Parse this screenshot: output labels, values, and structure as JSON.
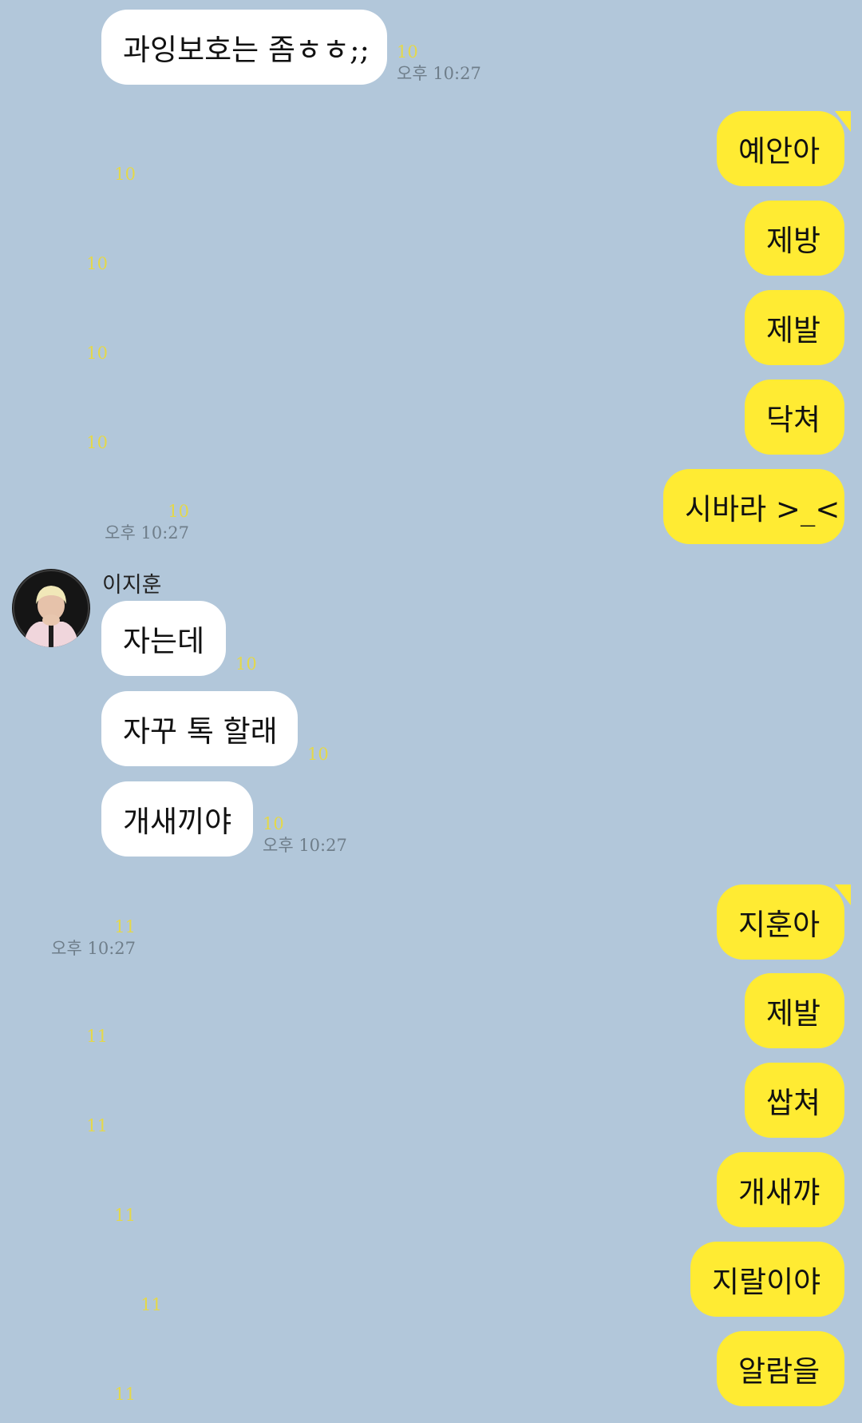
{
  "theme": {
    "background": "#b2c7da",
    "outgoing_bubble": "#ffeb33",
    "incoming_bubble": "#ffffff",
    "read_count_color": "#e4d84a",
    "timestamp_color": "#6f7e8a"
  },
  "contact": {
    "name": "이지훈",
    "avatar_icon": "profile-photo-icon"
  },
  "messages": [
    {
      "dir": "in",
      "text": "과잉보호는 좀ㅎㅎ;;",
      "read": "10",
      "time": "오후 10:27"
    },
    {
      "dir": "out",
      "text": "예안아",
      "read": "10",
      "time": ""
    },
    {
      "dir": "out",
      "text": "제방",
      "read": "10",
      "time": ""
    },
    {
      "dir": "out",
      "text": "제발",
      "read": "10",
      "time": ""
    },
    {
      "dir": "out",
      "text": "닥쳐",
      "read": "10",
      "time": ""
    },
    {
      "dir": "out",
      "text": "시바라 >_<",
      "read": "10",
      "time": "오후 10:27"
    },
    {
      "dir": "in",
      "text": "자는데",
      "read": "10",
      "time": ""
    },
    {
      "dir": "in",
      "text": "자꾸 톡 할래",
      "read": "10",
      "time": ""
    },
    {
      "dir": "in",
      "text": "개새끼야",
      "read": "10",
      "time": "오후 10:27"
    },
    {
      "dir": "out",
      "text": "지훈아",
      "read": "11",
      "time": "오후 10:27"
    },
    {
      "dir": "out",
      "text": "제발",
      "read": "11",
      "time": ""
    },
    {
      "dir": "out",
      "text": "쌉쳐",
      "read": "11",
      "time": ""
    },
    {
      "dir": "out",
      "text": "개새꺄",
      "read": "11",
      "time": ""
    },
    {
      "dir": "out",
      "text": "지랄이야",
      "read": "11",
      "time": ""
    },
    {
      "dir": "out",
      "text": "알람을",
      "read": "11",
      "time": ""
    }
  ]
}
